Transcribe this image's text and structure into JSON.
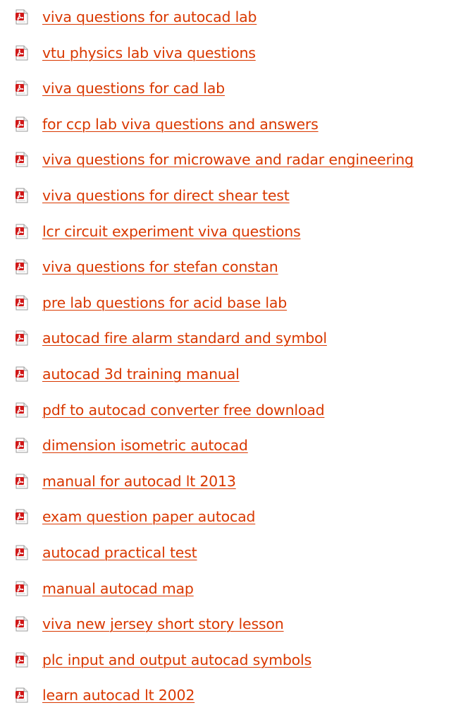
{
  "icon": "pdf-file-icon",
  "link_color": "#d93800",
  "items": [
    {
      "label": "viva questions for autocad lab"
    },
    {
      "label": "vtu physics lab viva questions"
    },
    {
      "label": "viva questions for cad lab"
    },
    {
      "label": "for ccp lab viva questions and answers"
    },
    {
      "label": "viva questions for microwave and radar engineering"
    },
    {
      "label": "viva questions for direct shear test"
    },
    {
      "label": "lcr circuit experiment viva questions"
    },
    {
      "label": "viva questions for stefan constan"
    },
    {
      "label": "pre lab questions for acid base lab"
    },
    {
      "label": "autocad fire alarm standard and symbol"
    },
    {
      "label": "autocad 3d training manual"
    },
    {
      "label": "pdf to autocad converter free download"
    },
    {
      "label": "dimension isometric autocad"
    },
    {
      "label": "manual for autocad lt 2013"
    },
    {
      "label": "exam question paper autocad"
    },
    {
      "label": "autocad practical test"
    },
    {
      "label": "manual autocad map"
    },
    {
      "label": "viva new jersey short story lesson"
    },
    {
      "label": "plc input and output autocad symbols"
    },
    {
      "label": "learn autocad lt 2002"
    }
  ]
}
